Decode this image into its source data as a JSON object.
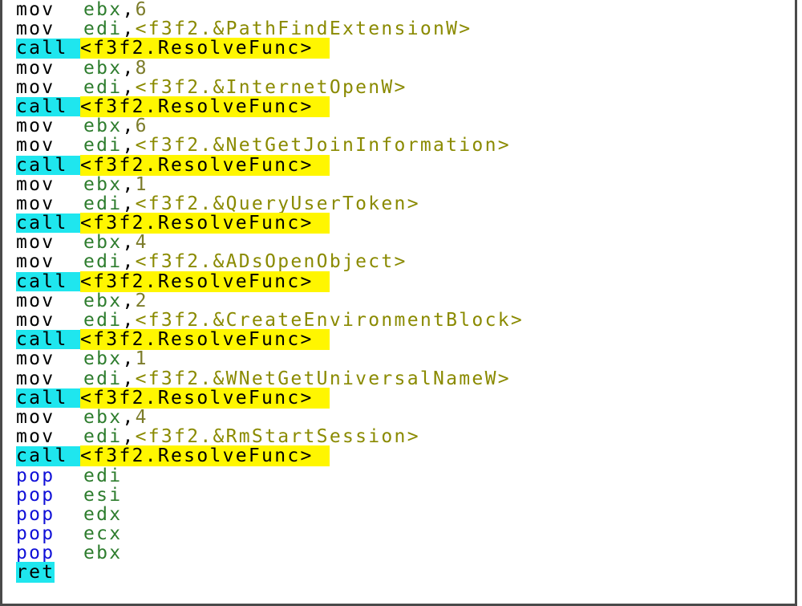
{
  "lines": [
    {
      "kind": "mov_num",
      "mnemonic": "mov",
      "reg": "ebx",
      "sep": ",",
      "value": "6"
    },
    {
      "kind": "mov_sym",
      "mnemonic": "mov",
      "reg": "edi",
      "sep": ",",
      "value": "<f3f2.&PathFindExtensionW>"
    },
    {
      "kind": "call",
      "mnemonic": "call",
      "target": "<f3f2.ResolveFunc>"
    },
    {
      "kind": "mov_num",
      "mnemonic": "mov",
      "reg": "ebx",
      "sep": ",",
      "value": "8"
    },
    {
      "kind": "mov_sym",
      "mnemonic": "mov",
      "reg": "edi",
      "sep": ",",
      "value": "<f3f2.&InternetOpenW>"
    },
    {
      "kind": "call",
      "mnemonic": "call",
      "target": "<f3f2.ResolveFunc>"
    },
    {
      "kind": "mov_num",
      "mnemonic": "mov",
      "reg": "ebx",
      "sep": ",",
      "value": "6"
    },
    {
      "kind": "mov_sym",
      "mnemonic": "mov",
      "reg": "edi",
      "sep": ",",
      "value": "<f3f2.&NetGetJoinInformation>"
    },
    {
      "kind": "call",
      "mnemonic": "call",
      "target": "<f3f2.ResolveFunc>"
    },
    {
      "kind": "mov_num",
      "mnemonic": "mov",
      "reg": "ebx",
      "sep": ",",
      "value": "1"
    },
    {
      "kind": "mov_sym",
      "mnemonic": "mov",
      "reg": "edi",
      "sep": ",",
      "value": "<f3f2.&QueryUserToken>"
    },
    {
      "kind": "call",
      "mnemonic": "call",
      "target": "<f3f2.ResolveFunc>"
    },
    {
      "kind": "mov_num",
      "mnemonic": "mov",
      "reg": "ebx",
      "sep": ",",
      "value": "4"
    },
    {
      "kind": "mov_sym",
      "mnemonic": "mov",
      "reg": "edi",
      "sep": ",",
      "value": "<f3f2.&ADsOpenObject>"
    },
    {
      "kind": "call",
      "mnemonic": "call",
      "target": "<f3f2.ResolveFunc>"
    },
    {
      "kind": "mov_num",
      "mnemonic": "mov",
      "reg": "ebx",
      "sep": ",",
      "value": "2"
    },
    {
      "kind": "mov_sym",
      "mnemonic": "mov",
      "reg": "edi",
      "sep": ",",
      "value": "<f3f2.&CreateEnvironmentBlock>"
    },
    {
      "kind": "call",
      "mnemonic": "call",
      "target": "<f3f2.ResolveFunc>"
    },
    {
      "kind": "mov_num",
      "mnemonic": "mov",
      "reg": "ebx",
      "sep": ",",
      "value": "1"
    },
    {
      "kind": "mov_sym",
      "mnemonic": "mov",
      "reg": "edi",
      "sep": ",",
      "value": "<f3f2.&WNetGetUniversalNameW>"
    },
    {
      "kind": "call",
      "mnemonic": "call",
      "target": "<f3f2.ResolveFunc>"
    },
    {
      "kind": "mov_num",
      "mnemonic": "mov",
      "reg": "ebx",
      "sep": ",",
      "value": "4"
    },
    {
      "kind": "mov_sym",
      "mnemonic": "mov",
      "reg": "edi",
      "sep": ",",
      "value": "<f3f2.&RmStartSession>"
    },
    {
      "kind": "call",
      "mnemonic": "call",
      "target": "<f3f2.ResolveFunc>"
    },
    {
      "kind": "pop",
      "mnemonic": "pop",
      "reg": "edi"
    },
    {
      "kind": "pop",
      "mnemonic": "pop",
      "reg": "esi"
    },
    {
      "kind": "pop",
      "mnemonic": "pop",
      "reg": "edx"
    },
    {
      "kind": "pop",
      "mnemonic": "pop",
      "reg": "ecx"
    },
    {
      "kind": "pop",
      "mnemonic": "pop",
      "reg": "ebx"
    },
    {
      "kind": "ret",
      "mnemonic": "ret"
    }
  ],
  "colors": {
    "background": "#ffffff",
    "border": "#4a4a4a",
    "call_highlight": "#1fe6ee",
    "target_highlight": "#fff600",
    "register": "#2e7d2e",
    "number": "#7c7c2a",
    "symbol": "#8a8a00",
    "pop": "#1010d8"
  }
}
